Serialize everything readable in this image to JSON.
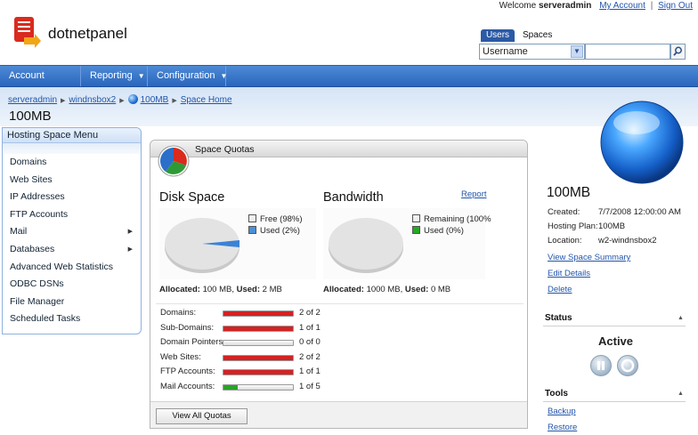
{
  "app": {
    "brand": "dotnetpanel",
    "welcome_prefix": "Welcome",
    "username": "serveradmin",
    "my_account": "My Account",
    "sign_out": "Sign Out"
  },
  "search": {
    "tabs": [
      "Users",
      "Spaces"
    ],
    "active_tab": "Users",
    "field_value": "Username",
    "input_value": ""
  },
  "nav": {
    "items": [
      {
        "label": "Account Home",
        "has_menu": false
      },
      {
        "label": "Reporting",
        "has_menu": true
      },
      {
        "label": "Configuration",
        "has_menu": true
      }
    ]
  },
  "breadcrumb": [
    "serveradmin",
    "windnsbox2",
    "100MB",
    "Space Home"
  ],
  "page_title": "100MB",
  "left_menu": {
    "title": "Hosting Space Menu",
    "items": [
      {
        "label": "Domains",
        "submenu": false
      },
      {
        "label": "Web Sites",
        "submenu": false
      },
      {
        "label": "IP Addresses",
        "submenu": false
      },
      {
        "label": "FTP Accounts",
        "submenu": false
      },
      {
        "label": "Mail",
        "submenu": true
      },
      {
        "label": "Databases",
        "submenu": true
      },
      {
        "label": "Advanced Web Statistics",
        "submenu": false
      },
      {
        "label": "ODBC DSNs",
        "submenu": false
      },
      {
        "label": "File Manager",
        "submenu": false
      },
      {
        "label": "Scheduled Tasks",
        "submenu": false
      }
    ]
  },
  "quotas": {
    "title": "Space Quotas",
    "disk": {
      "title": "Disk Space",
      "legend": [
        {
          "label": "Free (98%)",
          "color": "#f0f0f0",
          "percent": 98
        },
        {
          "label": "Used (2%)",
          "color": "#4a90d9",
          "percent": 2
        }
      ],
      "allocated_label": "Allocated:",
      "allocated_value": "100 MB,",
      "used_label": "Used:",
      "used_value": "2 MB"
    },
    "bandwidth": {
      "title": "Bandwidth",
      "report_link": "Report",
      "legend": [
        {
          "label": "Remaining (100%",
          "color": "#f0f0f0",
          "percent": 100
        },
        {
          "label": "Used (0%)",
          "color": "#22aa22",
          "percent": 0
        }
      ],
      "allocated_label": "Allocated:",
      "allocated_value": "1000 MB,",
      "used_label": "Used:",
      "used_value": "0 MB"
    },
    "rows": [
      {
        "label": "Domains:",
        "value": "2 of 2",
        "fill": 1.0,
        "color": "#d42222"
      },
      {
        "label": "Sub-Domains:",
        "value": "1 of 1",
        "fill": 1.0,
        "color": "#d42222"
      },
      {
        "label": "Domain Pointers:",
        "value": "0 of 0",
        "fill": 0.0,
        "color": "#d42222"
      },
      {
        "label": "Web Sites:",
        "value": "2 of 2",
        "fill": 1.0,
        "color": "#d42222"
      },
      {
        "label": "FTP Accounts:",
        "value": "1 of 1",
        "fill": 1.0,
        "color": "#d42222"
      },
      {
        "label": "Mail Accounts:",
        "value": "1 of 5",
        "fill": 0.2,
        "color": "#2aa22a"
      }
    ],
    "view_all_button": "View All Quotas"
  },
  "space": {
    "name": "100MB",
    "info": [
      {
        "key": "Created:",
        "value": "7/7/2008 12:00:00 AM"
      },
      {
        "key": "Hosting Plan:",
        "value": "100MB"
      },
      {
        "key": "Location:",
        "value": "w2-windnsbox2"
      }
    ],
    "links": [
      "View Space Summary",
      "Edit Details",
      "Delete"
    ],
    "status_title": "Status",
    "status_value": "Active",
    "tools_title": "Tools",
    "tools_links": [
      "Backup",
      "Restore"
    ]
  }
}
